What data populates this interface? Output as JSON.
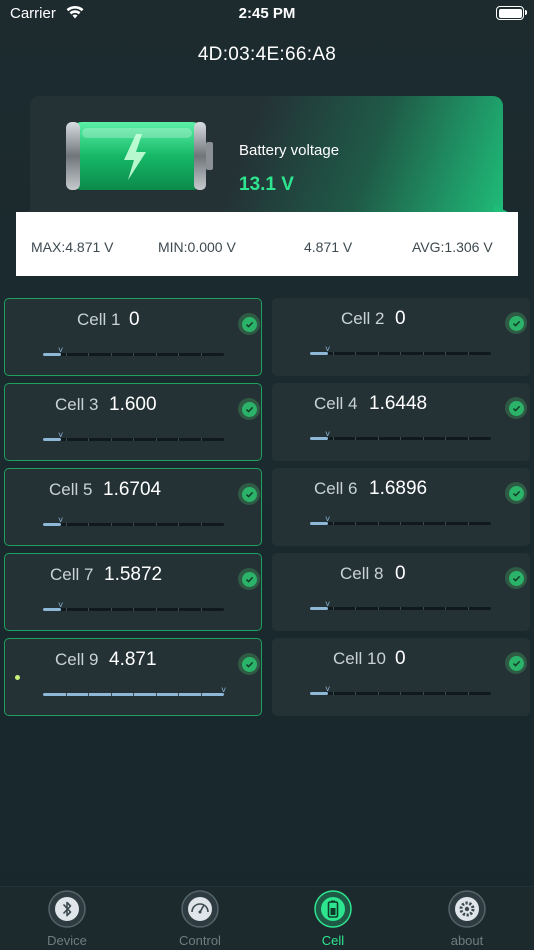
{
  "status_bar": {
    "carrier": "Carrier",
    "time": "2:45 PM"
  },
  "device": {
    "mac": "4D:03:4E:66:A8"
  },
  "battery": {
    "label": "Battery voltage",
    "value": "13.1 V"
  },
  "stats": {
    "max": "MAX:4.871 V",
    "min": "MIN:0.000 V",
    "diff": "4.871 V",
    "avg": "AVG:1.306 V"
  },
  "cells": [
    {
      "label": "Cell 1",
      "value": "0",
      "level": 0,
      "active": true
    },
    {
      "label": "Cell 2",
      "value": "0",
      "level": 0,
      "active": false
    },
    {
      "label": "Cell 3",
      "value": "1.600",
      "level": 0,
      "active": true
    },
    {
      "label": "Cell 4",
      "value": "1.6448",
      "level": 0,
      "active": false
    },
    {
      "label": "Cell 5",
      "value": "1.6704",
      "level": 0,
      "active": true
    },
    {
      "label": "Cell 6",
      "value": "1.6896",
      "level": 0,
      "active": false
    },
    {
      "label": "Cell 7",
      "value": "1.5872",
      "level": 0,
      "active": true
    },
    {
      "label": "Cell 8",
      "value": "0",
      "level": 0,
      "active": false
    },
    {
      "label": "Cell 9",
      "value": "4.871",
      "level": 1,
      "active": true
    },
    {
      "label": "Cell 10",
      "value": "0",
      "level": 0,
      "active": false
    }
  ],
  "tabs": [
    {
      "label": "Device",
      "icon": "bluetooth-icon"
    },
    {
      "label": "Control",
      "icon": "dashboard-gauge-icon"
    },
    {
      "label": "Cell",
      "icon": "battery-cell-icon",
      "selected": true
    },
    {
      "label": "about",
      "icon": "gear-icon"
    }
  ],
  "colors": {
    "accent": "#2ee58f",
    "cell_border": "#1ea05e",
    "slider_fill": "#8fb7d8"
  }
}
